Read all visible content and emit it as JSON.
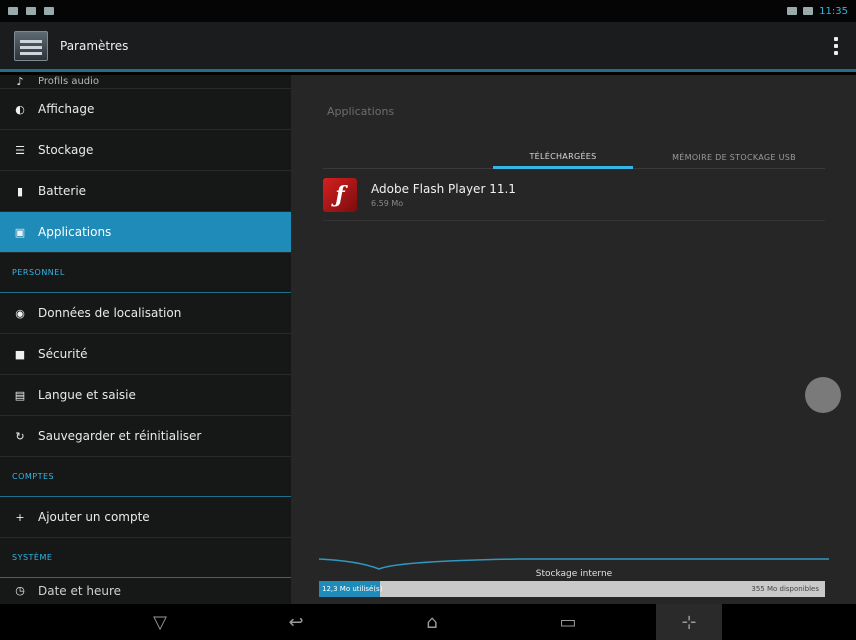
{
  "window": {
    "title": "Paramètres"
  },
  "sidebar": {
    "top_partial": "Profils audio",
    "items": [
      {
        "label": "Affichage",
        "icon": "display-icon"
      },
      {
        "label": "Stockage",
        "icon": "storage-icon"
      },
      {
        "label": "Batterie",
        "icon": "battery-icon"
      },
      {
        "label": "Applications",
        "icon": "apps-icon",
        "active": true
      }
    ],
    "section_personnel": "PERSONNEL",
    "personnel_items": [
      {
        "label": "Données de localisation",
        "icon": "location-icon"
      },
      {
        "label": "Sécurité",
        "icon": "lock-icon"
      },
      {
        "label": "Langue et saisie",
        "icon": "language-icon"
      },
      {
        "label": "Sauvegarder et réinitialiser",
        "icon": "backup-icon"
      }
    ],
    "section_comptes": "COMPTES",
    "comptes_items": [
      {
        "label": "Ajouter un compte",
        "icon": "add-icon"
      }
    ],
    "section_systeme": "SYSTÈME",
    "bottom_partial": "Date et heure"
  },
  "main": {
    "panel_title": "Applications",
    "tabs": [
      {
        "label": "TÉLÉCHARGÉES"
      },
      {
        "label": "MÉMOIRE DE STOCKAGE USB"
      }
    ],
    "apps": [
      {
        "name": "Adobe Flash Player 11.1",
        "size": "6.59 Mo"
      }
    ],
    "storage": {
      "label": "Stockage interne",
      "used_text": "12,3 Mo utilisé(s)",
      "free_text": "355 Mo disponibles",
      "used_fraction": 0.12
    }
  },
  "statusbar": {
    "time": "11:35"
  }
}
